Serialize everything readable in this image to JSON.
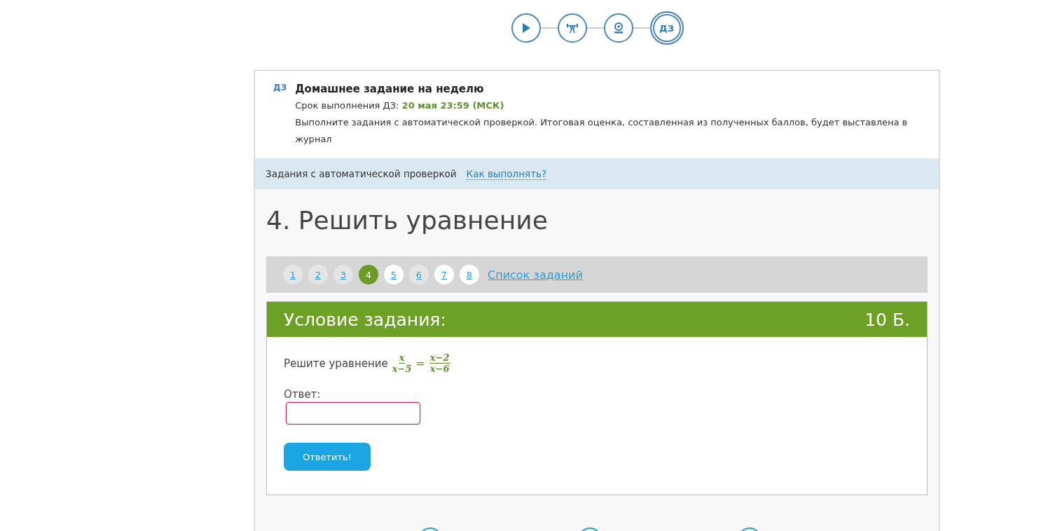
{
  "steps": [
    {
      "kind": "play",
      "selected": false
    },
    {
      "kind": "weights",
      "selected": false
    },
    {
      "kind": "webcam",
      "selected": false
    },
    {
      "kind": "text",
      "label": "ДЗ",
      "selected": true
    }
  ],
  "homework": {
    "badge": "ДЗ",
    "title": "Домашнее задание на неделю",
    "deadline_label": "Срок выполнения ДЗ:",
    "deadline": "20 мая 23:59 (МСК)",
    "description": "Выполните задания с автоматической проверкой. Итоговая оценка, составленная из полученных баллов, будет выставлена в журнал"
  },
  "info_bar": {
    "text": "Задания с автоматической проверкой",
    "link": "Как выполнять?"
  },
  "task_title": "4. Решить уравнение",
  "task_nav": {
    "items": [
      {
        "label": "1",
        "selected": false,
        "visited": true
      },
      {
        "label": "2",
        "selected": false,
        "visited": true
      },
      {
        "label": "3",
        "selected": false,
        "visited": true
      },
      {
        "label": "4",
        "selected": true,
        "visited": true
      },
      {
        "label": "5",
        "selected": false,
        "visited": false
      },
      {
        "label": "6",
        "selected": false,
        "visited": true
      },
      {
        "label": "7",
        "selected": false,
        "visited": false
      },
      {
        "label": "8",
        "selected": false,
        "visited": false
      }
    ],
    "list_link": "Список заданий"
  },
  "condition": {
    "heading": "Условие задания:",
    "points": "10 Б.",
    "prompt": "Решите уравнение",
    "equation": {
      "left": {
        "numerator": "x",
        "denominator": "x−5"
      },
      "operator": "=",
      "right": {
        "numerator": "x−2",
        "denominator": "x−6"
      }
    },
    "answer_label": "Ответ:",
    "submit": "Ответить!"
  }
}
